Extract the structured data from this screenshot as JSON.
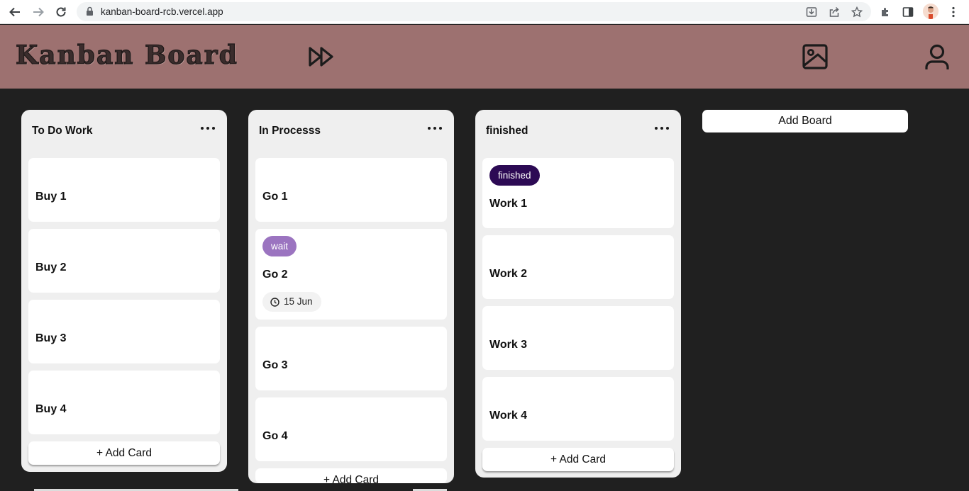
{
  "browser": {
    "url": "kanban-board-rcb.vercel.app"
  },
  "app": {
    "title": "Kanban Board",
    "header_color": "#9d7170",
    "background_color": "#202020"
  },
  "boards": [
    {
      "title": "To Do Work",
      "cards": [
        {
          "title": "Buy 1"
        },
        {
          "title": "Buy 2"
        },
        {
          "title": "Buy 3"
        },
        {
          "title": "Buy 4"
        }
      ],
      "add_card_label": "+ Add Card"
    },
    {
      "title": "In Processs",
      "cards": [
        {
          "title": "Go 1"
        },
        {
          "title": "Go 2",
          "label": {
            "text": "wait",
            "color": "#9b74c0"
          },
          "date": "15 Jun"
        },
        {
          "title": "Go 3"
        },
        {
          "title": "Go 4"
        }
      ],
      "add_card_label": "+ Add Card"
    },
    {
      "title": "finished",
      "cards": [
        {
          "title": "Work 1",
          "label": {
            "text": "finished",
            "color": "#2c0a54"
          }
        },
        {
          "title": "Work 2"
        },
        {
          "title": "Work 3"
        },
        {
          "title": "Work 4"
        }
      ],
      "add_card_label": "+ Add Card"
    }
  ],
  "add_board_label": "Add Board",
  "icons": {
    "header": [
      "fast-forward-icon",
      "image-icon",
      "user-icon"
    ],
    "chrome": [
      "back-icon",
      "forward-icon",
      "reload-icon",
      "lock-icon",
      "install-icon",
      "share-icon",
      "star-icon",
      "extensions-icon",
      "sidepanel-icon",
      "kebab-menu-icon"
    ]
  }
}
